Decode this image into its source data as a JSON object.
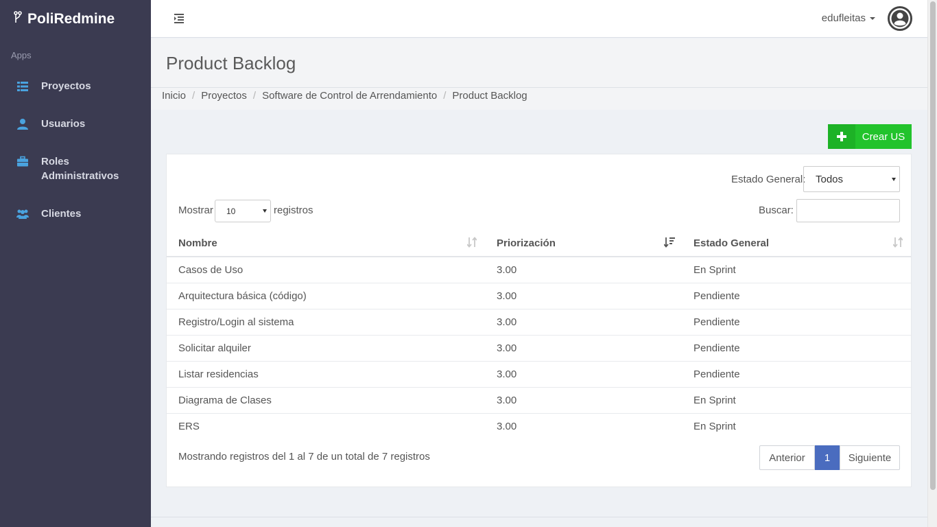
{
  "sidebar": {
    "brand": "PoliRedmine",
    "section_label": "Apps",
    "items": [
      {
        "label": "Proyectos",
        "icon": "list-icon"
      },
      {
        "label": "Usuarios",
        "icon": "user-icon"
      },
      {
        "label": "Roles Administrativos",
        "icon": "briefcase-icon"
      },
      {
        "label": "Clientes",
        "icon": "users-icon"
      }
    ]
  },
  "topbar": {
    "username": "edufleitas"
  },
  "header": {
    "title": "Product Backlog",
    "breadcrumb": [
      "Inicio",
      "Proyectos",
      "Software de Control de Arrendamiento",
      "Product Backlog"
    ]
  },
  "actions": {
    "create_label": "Crear US"
  },
  "filters": {
    "estado_label": "Estado General:",
    "estado_value": "Todos",
    "mostrar_label": "Mostrar",
    "length_value": "10",
    "registros_label": "registros",
    "buscar_label": "Buscar:",
    "buscar_value": ""
  },
  "table": {
    "columns": [
      "Nombre",
      "Priorización",
      "Estado General"
    ],
    "rows": [
      [
        "Casos de Uso",
        "3.00",
        "En Sprint"
      ],
      [
        "Arquitectura básica (código)",
        "3.00",
        "Pendiente"
      ],
      [
        "Registro/Login al sistema",
        "3.00",
        "Pendiente"
      ],
      [
        "Solicitar alquiler",
        "3.00",
        "Pendiente"
      ],
      [
        "Listar residencias",
        "3.00",
        "Pendiente"
      ],
      [
        "Diagrama de Clases",
        "3.00",
        "En Sprint"
      ],
      [
        "ERS",
        "3.00",
        "En Sprint"
      ]
    ]
  },
  "footer": {
    "info": "Mostrando registros del 1 al 7 de un total de 7 registros",
    "prev_label": "Anterior",
    "page": "1",
    "next_label": "Siguiente"
  },
  "colors": {
    "sidebar_bg": "#3b3b51",
    "accent_icon": "#4aa3df",
    "create_green": "#22c32c",
    "pager_active": "#4a6cbf"
  }
}
